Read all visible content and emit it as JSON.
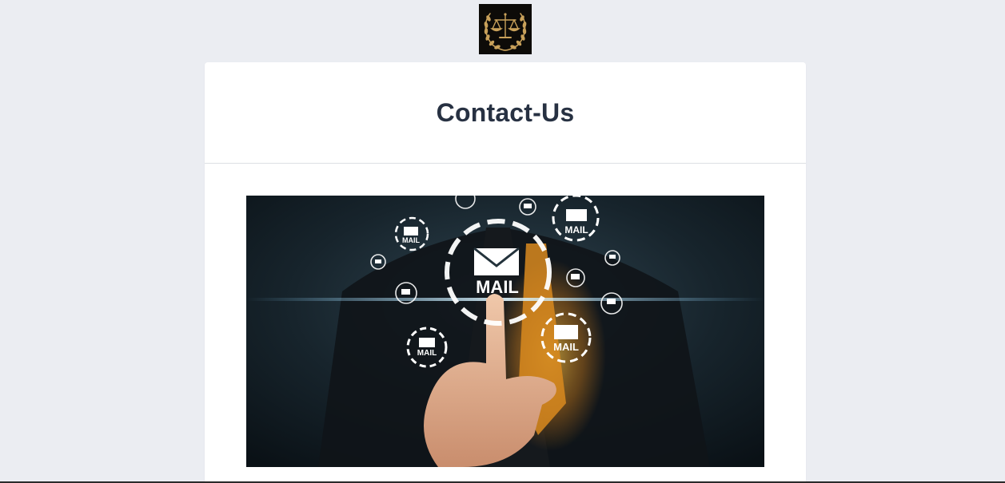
{
  "logo": {
    "name": "scales-of-justice-laurel-logo",
    "colors": {
      "background": "#0d0b08",
      "gold": "#c9a15a"
    }
  },
  "page": {
    "background": "#ebedf2",
    "title": "Contact-Us"
  },
  "hero_image": {
    "name": "finger-touching-mail-icons-image",
    "icon_labels": [
      "MAIL",
      "MAIL",
      "MAIL",
      "MAIL",
      "MAIL"
    ]
  }
}
